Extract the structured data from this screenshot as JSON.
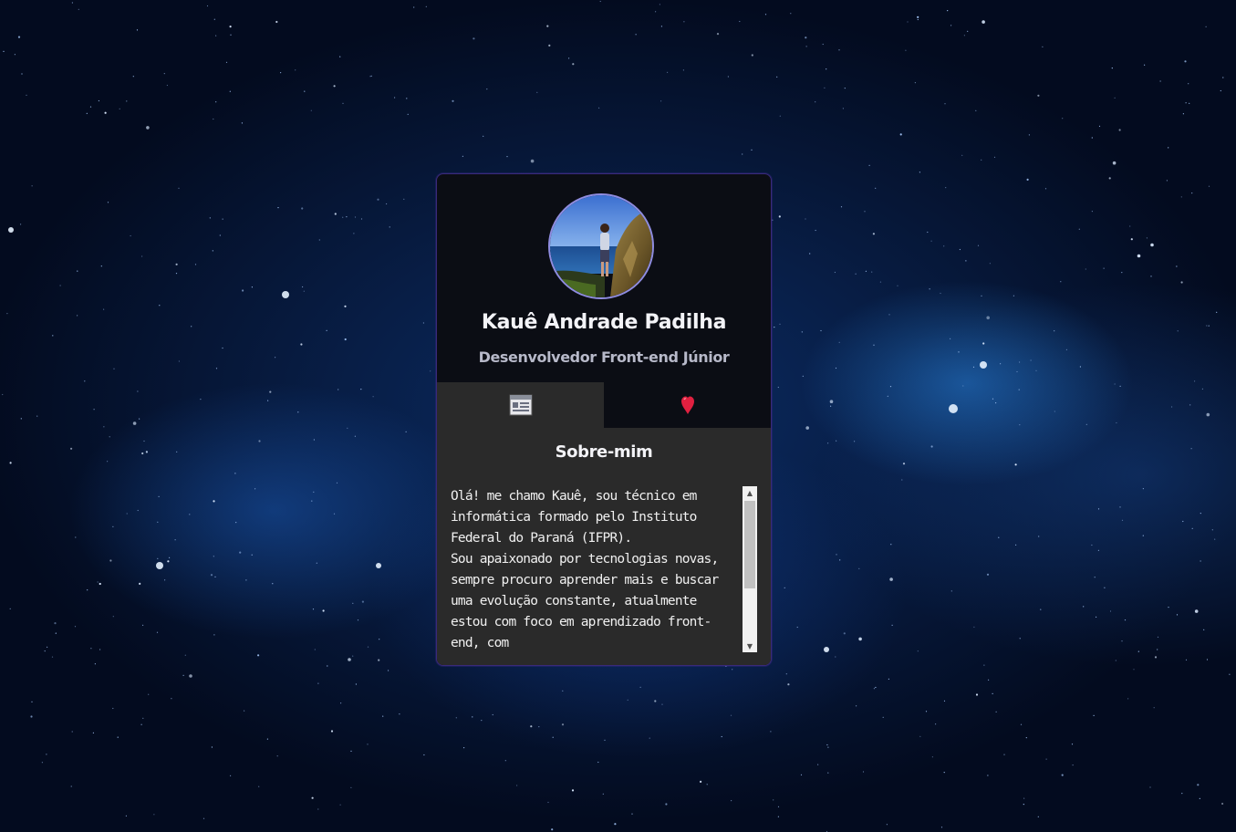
{
  "profile": {
    "name": "Kauê Andrade Padilha",
    "role": "Desenvolvedor Front-end Júnior"
  },
  "tabs": [
    {
      "icon": "document-icon",
      "active": true
    },
    {
      "icon": "heart-icon",
      "active": false
    }
  ],
  "about": {
    "title": "Sobre-mim",
    "paragraph1": "Olá! me chamo Kauê, sou técnico em informática formado pelo Instituto Federal do Paraná (IFPR).",
    "paragraph2": "Sou apaixonado por tecnologias novas, sempre procuro aprender mais e buscar uma evolução constante, atualmente estou com foco em aprendizado front-end, com"
  },
  "colors": {
    "card_bg": "#0b0d14",
    "panel_bg": "#2a2a2a",
    "avatar_border": "#8f8ce0",
    "heart": "#e02040"
  }
}
